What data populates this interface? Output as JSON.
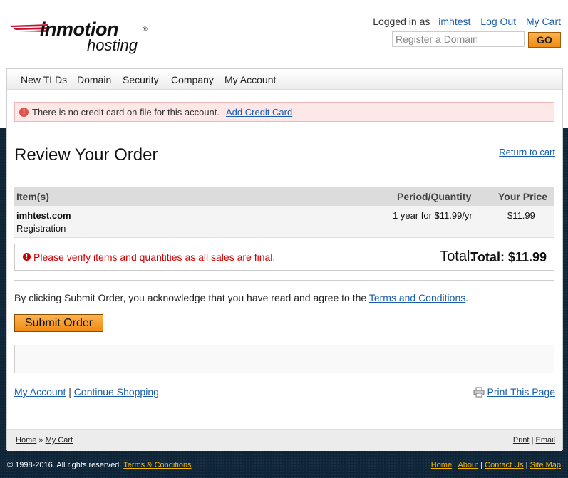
{
  "logo": {
    "brand": "inmotion",
    "reg": "®",
    "sub": "hosting"
  },
  "topnav": {
    "logged_in_prefix": "Logged in as",
    "username": "imhtest",
    "logout": "Log Out",
    "cart": "My Cart"
  },
  "domain_search": {
    "placeholder": "Register a Domain",
    "go": "GO"
  },
  "mainnav": [
    "New TLDs",
    "Domain",
    "Security",
    "Company",
    "My Account"
  ],
  "alert": {
    "icon": "!",
    "message": "There is no credit card on file for this account.",
    "link": "Add Credit Card"
  },
  "page": {
    "title": "Review Your Order",
    "return_link": "Return to cart"
  },
  "table": {
    "headers": [
      "Item(s)",
      "Period/Quantity",
      "Your Price"
    ],
    "rows": [
      {
        "name": "imhtest.com",
        "type": "Registration",
        "period": "1 year for $11.99/yr",
        "price": "$11.99"
      }
    ]
  },
  "total": {
    "warning_icon": "!",
    "warning": "Please verify items and quantities as all sales are final.",
    "label": "Total:",
    "value": "Total: $11.99"
  },
  "agree": {
    "text": "By clicking Submit Order, you acknowledge that you have read and agree to the",
    "link": "Terms and Conditions",
    "period": "."
  },
  "submit": "Submit Order",
  "bottom_links": {
    "account": "My Account",
    "separator": "|",
    "shopping": "Continue Shopping",
    "print": "Print This Page"
  },
  "crumbs": {
    "home": "Home",
    "sep": "»",
    "cart": "My Cart",
    "print": "Print",
    "email": "Email",
    "bar": "|"
  },
  "footer": {
    "copyright": "© 1998-2016. All rights reserved.",
    "terms": "Terms & Conditions",
    "links": [
      "Home",
      "About",
      "Contact Us",
      "Site Map"
    ],
    "sep": "|"
  },
  "colors": {
    "accent": "#f08a12",
    "link": "#1a5ea8",
    "footer_bg": "#0e2538",
    "error": "#cc0000"
  }
}
